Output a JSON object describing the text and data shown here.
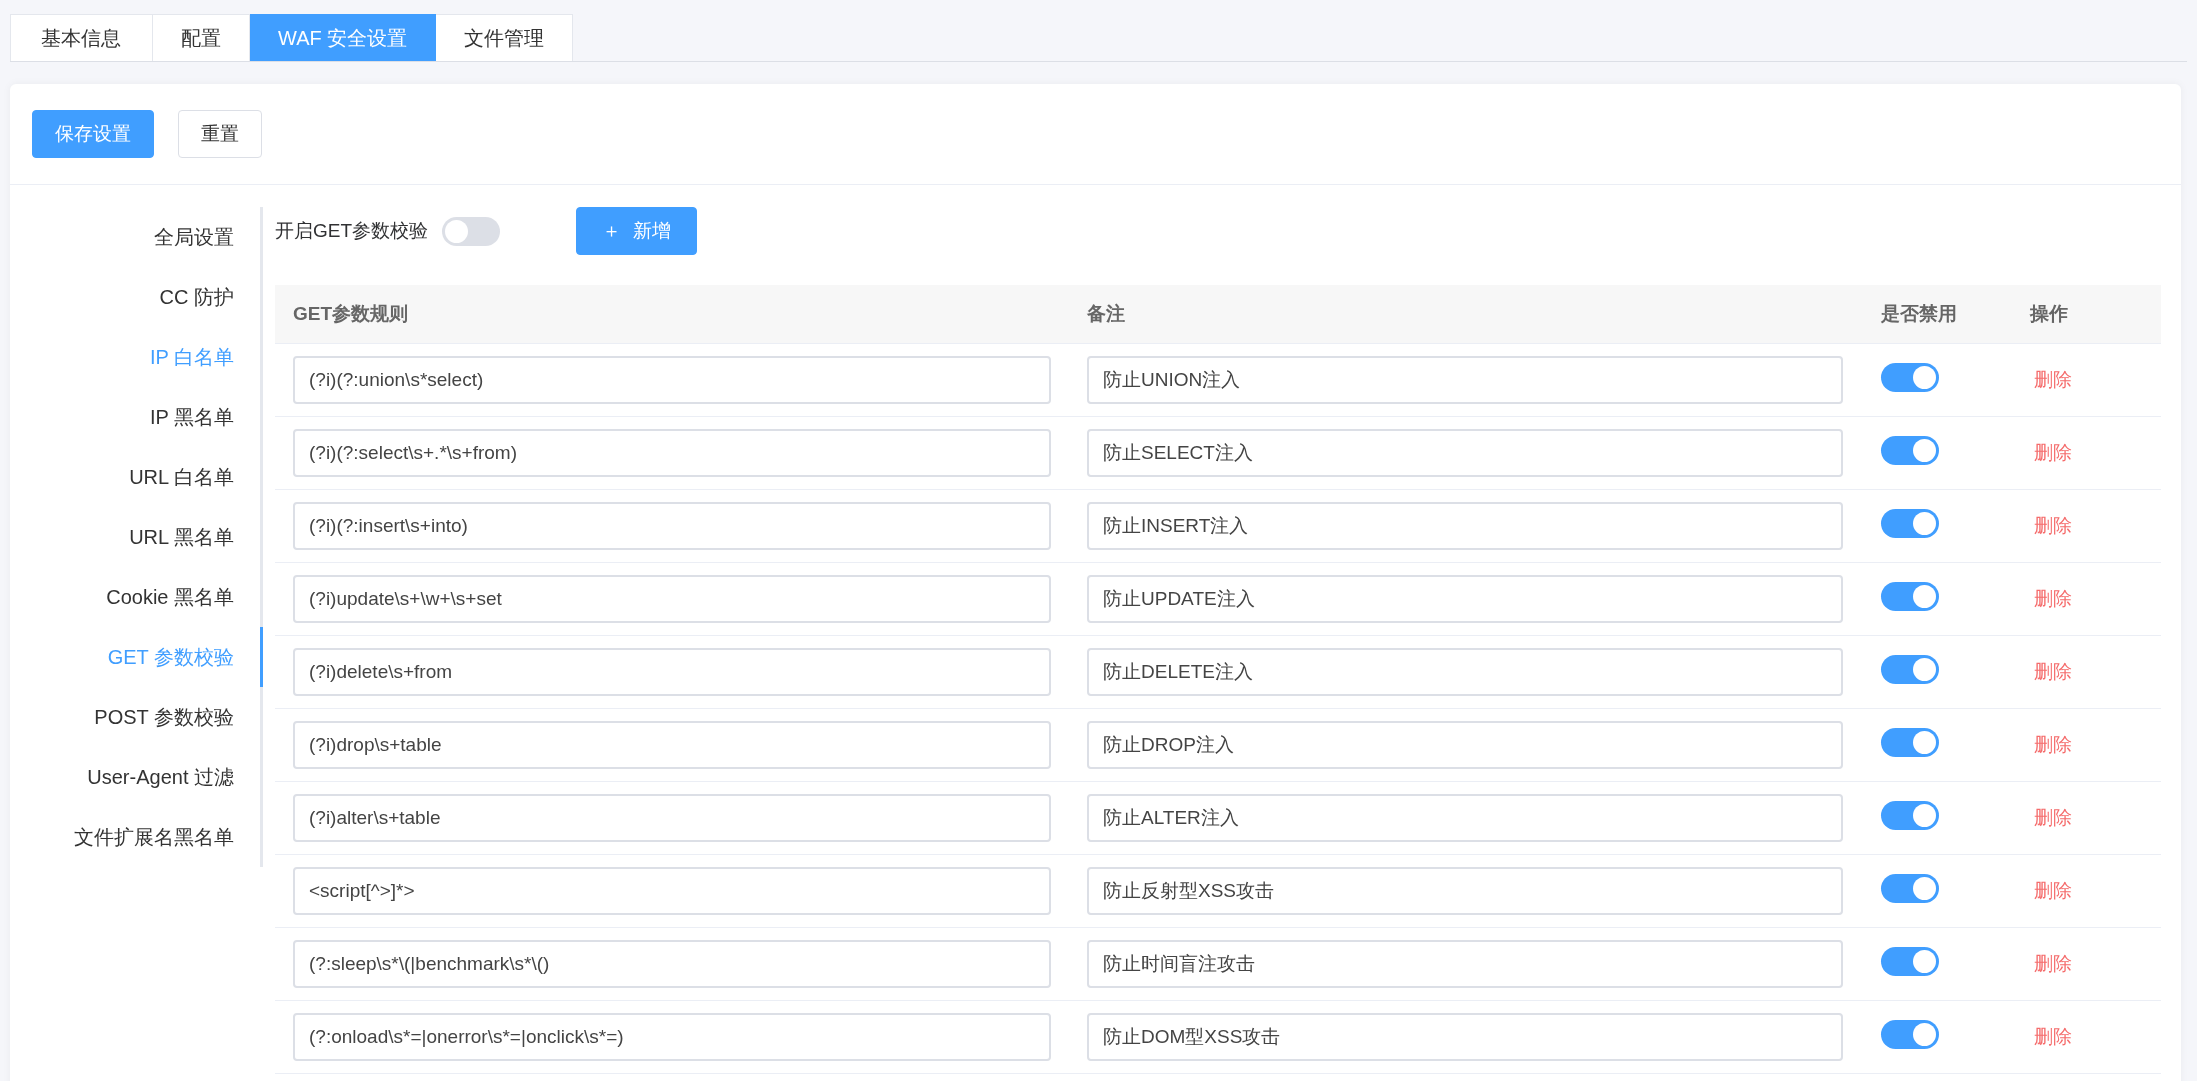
{
  "tabs": [
    {
      "label": "基本信息",
      "selected": false
    },
    {
      "label": "配置",
      "selected": false
    },
    {
      "label": "WAF 安全设置",
      "selected": true
    },
    {
      "label": "文件管理",
      "selected": false
    }
  ],
  "toolbar": {
    "save_button": "保存设置",
    "reset_button": "重置"
  },
  "sidebar": {
    "items": [
      {
        "label": "全局设置",
        "selected": false,
        "hovered": false
      },
      {
        "label": "CC 防护",
        "selected": false,
        "hovered": false
      },
      {
        "label": "IP 白名单",
        "selected": false,
        "hovered": true
      },
      {
        "label": "IP 黑名单",
        "selected": false,
        "hovered": false
      },
      {
        "label": "URL 白名单",
        "selected": false,
        "hovered": false
      },
      {
        "label": "URL 黑名单",
        "selected": false,
        "hovered": false
      },
      {
        "label": "Cookie 黑名单",
        "selected": false,
        "hovered": false
      },
      {
        "label": "GET 参数校验",
        "selected": true,
        "hovered": false
      },
      {
        "label": "POST 参数校验",
        "selected": false,
        "hovered": false
      },
      {
        "label": "User-Agent 过滤",
        "selected": false,
        "hovered": false
      },
      {
        "label": "文件扩展名黑名单",
        "selected": false,
        "hovered": false
      }
    ]
  },
  "enable": {
    "label": "开启GET参数校验",
    "on": false
  },
  "add_button": {
    "icon": "＋",
    "label": "新增"
  },
  "table": {
    "columns": [
      "GET参数规则",
      "备注",
      "是否禁用",
      "操作"
    ],
    "rows": [
      {
        "rule": "(?i)(?:union\\s*select)",
        "note": "防止UNION注入",
        "on": true,
        "action": "删除"
      },
      {
        "rule": "(?i)(?:select\\s+.*\\s+from)",
        "note": "防止SELECT注入",
        "on": true,
        "action": "删除"
      },
      {
        "rule": "(?i)(?:insert\\s+into)",
        "note": "防止INSERT注入",
        "on": true,
        "action": "删除"
      },
      {
        "rule": "(?i)update\\s+\\w+\\s+set",
        "note": "防止UPDATE注入",
        "on": true,
        "action": "删除"
      },
      {
        "rule": "(?i)delete\\s+from",
        "note": "防止DELETE注入",
        "on": true,
        "action": "删除"
      },
      {
        "rule": "(?i)drop\\s+table",
        "note": "防止DROP注入",
        "on": true,
        "action": "删除"
      },
      {
        "rule": "(?i)alter\\s+table",
        "note": "防止ALTER注入",
        "on": true,
        "action": "删除"
      },
      {
        "rule": "<script[^>]*>",
        "note": "防止反射型XSS攻击",
        "on": true,
        "action": "删除"
      },
      {
        "rule": "(?:sleep\\s*\\(|benchmark\\s*\\()",
        "note": "防止时间盲注攻击",
        "on": true,
        "action": "删除"
      },
      {
        "rule": "(?:onload\\s*=|onerror\\s*=|onclick\\s*=)",
        "note": "防止DOM型XSS攻击",
        "on": true,
        "action": "删除"
      }
    ]
  }
}
